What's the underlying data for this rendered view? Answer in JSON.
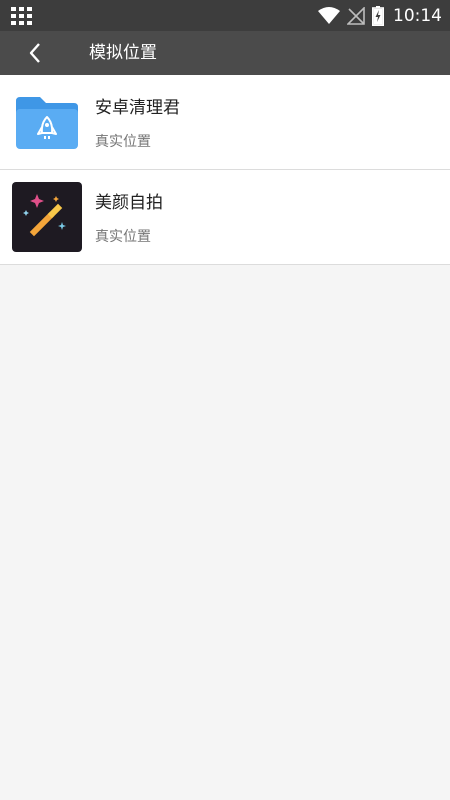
{
  "status_bar": {
    "time": "10:14",
    "icons": [
      "app-grid-icon",
      "wifi-icon",
      "no-signal-icon",
      "battery-charging-icon"
    ]
  },
  "app_bar": {
    "back_icon": "back-arrow-icon",
    "title": "模拟位置"
  },
  "list": {
    "items": [
      {
        "name": "安卓清理君",
        "subtitle": "真实位置",
        "icon": "folder-rocket-icon"
      },
      {
        "name": "美颜自拍",
        "subtitle": "真实位置",
        "icon": "magic-wand-icon"
      }
    ]
  },
  "colors": {
    "status_bar_bg": "#3d3d3d",
    "app_bar_bg": "#4b4b4b",
    "page_bg": "#f5f5f5",
    "folder_blue": "#4da6f0",
    "wand_icon_bg": "#1e1a22"
  }
}
